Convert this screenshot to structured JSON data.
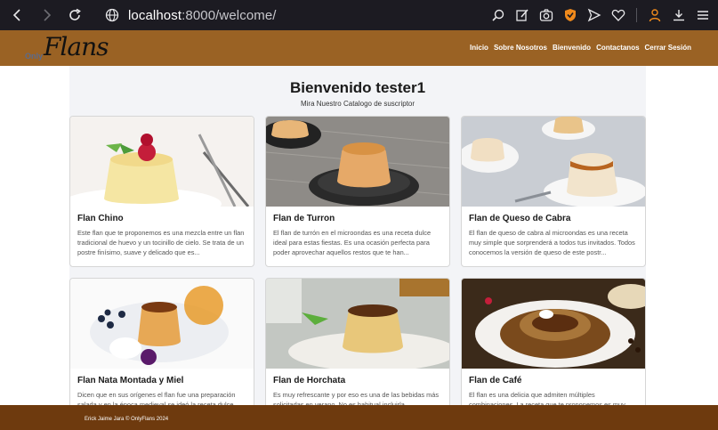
{
  "browser": {
    "url_host": "localhost",
    "url_path": ":8000/welcome/"
  },
  "site": {
    "logo_prefix": "Only",
    "logo_script": "Flans",
    "menu": [
      {
        "label": "Inicio"
      },
      {
        "label": "Sobre Nosotros"
      },
      {
        "label": "Bienvenido"
      },
      {
        "label": "Contactanos"
      },
      {
        "label": "Cerrar Sesión"
      }
    ]
  },
  "main": {
    "title": "Bienvenido tester1",
    "subtitle": "Mira Nuestro Catalogo de suscriptor",
    "cards": [
      {
        "title": "Flan Chino",
        "text": "Este flan que te proponemos es una mezcla entre un flan tradicional de huevo y un tocinillo de cielo. Se trata de un postre finísimo, suave y delicado que es..."
      },
      {
        "title": "Flan de Turron",
        "text": "El flan de turrón en el microondas es una receta dulce ideal para estas fiestas. Es una ocasión perfecta para poder aprovechar aquellos restos que te han..."
      },
      {
        "title": "Flan de Queso de Cabra",
        "text": "El flan de queso de cabra al microondas es una receta muy simple que sorprenderá a todos tus invitados. Todos conocemos la versión de queso de este postr..."
      },
      {
        "title": "Flan Nata Montada y Miel",
        "text": "Dicen que en sus orígenes el flan fue una preparación salada y en la época medieval se ideó la receta dulce..."
      },
      {
        "title": "Flan de Horchata",
        "text": "Es muy refrescante y por eso es una de las bebidas más solicitadas en verano. No es habitual incluirla..."
      },
      {
        "title": "Flan de Café",
        "text": "El flan es una delicia que admiten múltiples combinaciones. La receta que te proponemos es muy..."
      }
    ]
  },
  "footer": {
    "text": "Erick Jaime Jara © OnlyFlans 2024"
  },
  "colors": {
    "header": "#9a6224",
    "footer": "#6e3a0e",
    "chrome": "#1c1b22"
  }
}
